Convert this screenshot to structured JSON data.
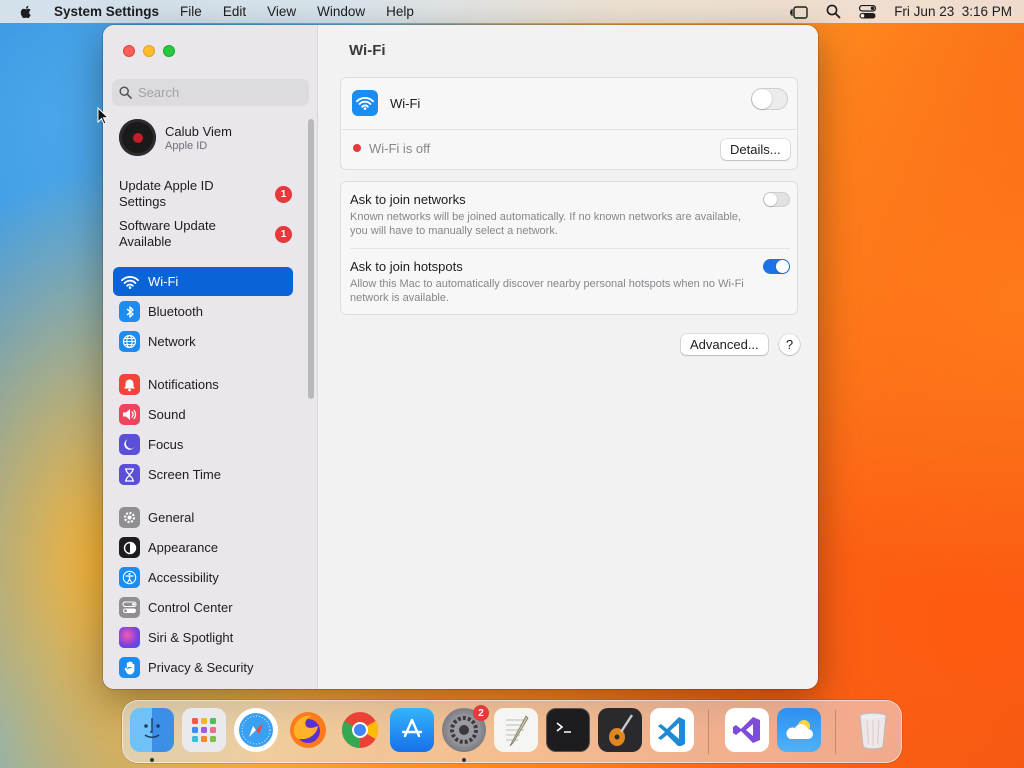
{
  "menubar": {
    "app_name": "System Settings",
    "menus": [
      "File",
      "Edit",
      "View",
      "Window",
      "Help"
    ],
    "clock": "Fri Jun 23  3:16 PM"
  },
  "sidebar": {
    "search_placeholder": "Search",
    "profile": {
      "name": "Calub Viem",
      "subtitle": "Apple ID"
    },
    "notices": [
      {
        "label": "Update Apple ID Settings",
        "badge": "1"
      },
      {
        "label": "Software Update Available",
        "badge": "1"
      }
    ],
    "items": [
      {
        "label": "Wi-Fi",
        "icon": "wifi-icon",
        "color": "#1a8cf2",
        "active": true
      },
      {
        "label": "Bluetooth",
        "icon": "bluetooth-icon",
        "color": "#1a8cf2"
      },
      {
        "label": "Network",
        "icon": "globe-icon",
        "color": "#1a8cf2"
      },
      {
        "label": "Notifications",
        "icon": "bell-icon",
        "color": "#f0443a"
      },
      {
        "label": "Sound",
        "icon": "speaker-icon",
        "color": "#f0445e"
      },
      {
        "label": "Focus",
        "icon": "moon-icon",
        "color": "#5a4fd6"
      },
      {
        "label": "Screen Time",
        "icon": "hourglass-icon",
        "color": "#5a4fd6"
      },
      {
        "label": "General",
        "icon": "gear-icon",
        "color": "#8e8e93"
      },
      {
        "label": "Appearance",
        "icon": "appearance-icon",
        "color": "#1d1d1f"
      },
      {
        "label": "Accessibility",
        "icon": "accessibility-icon",
        "color": "#1a8cf2"
      },
      {
        "label": "Control Center",
        "icon": "control-center-icon",
        "color": "#8e8e93"
      },
      {
        "label": "Siri & Spotlight",
        "icon": "siri-icon",
        "color": "#b24bd8"
      },
      {
        "label": "Privacy & Security",
        "icon": "hand-icon",
        "color": "#1a8cf2"
      }
    ]
  },
  "main": {
    "title": "Wi-Fi",
    "wifi_label": "Wi-Fi",
    "wifi_on": false,
    "status_text": "Wi-Fi is off",
    "status_color": "#e5393b",
    "details_button": "Details...",
    "options": [
      {
        "title": "Ask to join networks",
        "description": "Known networks will be joined automatically. If no known networks are available, you will have to manually select a network.",
        "on": false
      },
      {
        "title": "Ask to join hotspots",
        "description": "Allow this Mac to automatically discover nearby personal hotspots when no Wi-Fi network is available.",
        "on": true
      }
    ],
    "advanced_button": "Advanced...",
    "help_button": "?"
  },
  "dock": {
    "apps": [
      "Finder",
      "Launchpad",
      "Safari",
      "Firefox",
      "Chrome",
      "App Store",
      "System Settings",
      "TextEdit",
      "Terminal",
      "GarageBand",
      "Visual Studio Code",
      "Visual Studio",
      "Weather",
      "Trash"
    ],
    "system_settings_badge": "2"
  }
}
